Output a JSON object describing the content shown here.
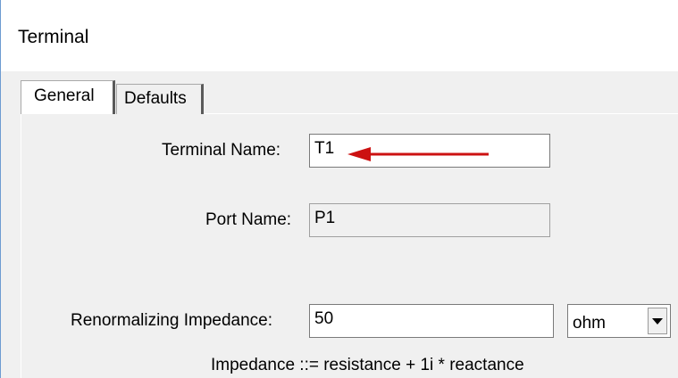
{
  "window": {
    "title": "Terminal"
  },
  "tabs": [
    {
      "label": "General",
      "active": true
    },
    {
      "label": "Defaults",
      "active": false
    }
  ],
  "form": {
    "terminal_name_label": "Terminal Name:",
    "terminal_name_value": "T1",
    "port_name_label": "Port Name:",
    "port_name_value": "P1",
    "impedance_label": "Renormalizing Impedance:",
    "impedance_value": "50",
    "impedance_unit": "ohm",
    "impedance_note": "Impedance ::= resistance + 1i * reactance"
  },
  "annotation": {
    "arrow_color": "#cc1111",
    "icon": "red-arrow-left"
  }
}
